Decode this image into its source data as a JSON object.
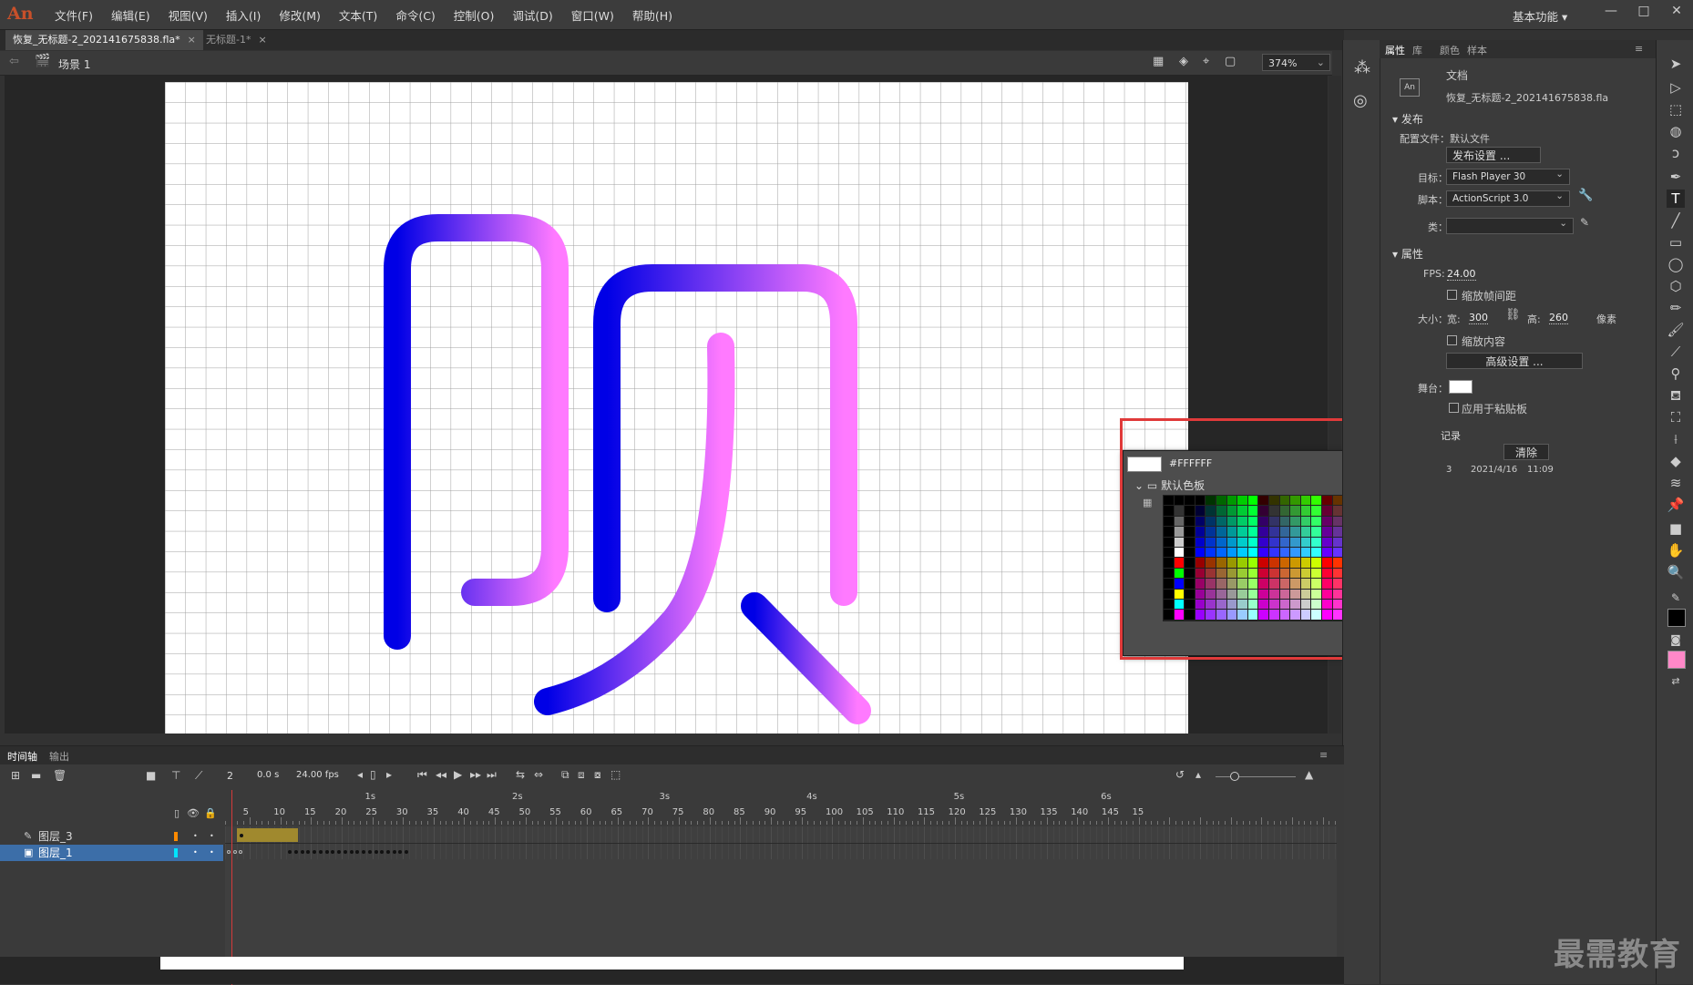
{
  "app": {
    "logo": "An",
    "menu": [
      "文件(F)",
      "编辑(E)",
      "视图(V)",
      "插入(I)",
      "修改(M)",
      "文本(T)",
      "命令(C)",
      "控制(O)",
      "调试(D)",
      "窗口(W)",
      "帮助(H)"
    ],
    "workspace": "基本功能",
    "window_buttons": [
      "—",
      "□",
      "✕"
    ]
  },
  "doc_tabs": [
    {
      "label": "恢复_无标题-2_202141675838.fla*",
      "close": "×"
    },
    {
      "label": "无标题-1*",
      "close": "×"
    }
  ],
  "edit_bar": {
    "scene": "场景 1",
    "zoom": "374%"
  },
  "stage": {
    "character": "帧",
    "gradient_start": "#0000e6",
    "gradient_end": "#ff7aff",
    "grid_color": "#a0a0a0",
    "background": "#ffffff"
  },
  "swatch_popup": {
    "hex": "#FFFFFF",
    "folder_label": "默认色板"
  },
  "properties_panel": {
    "tabs": [
      "属性",
      "库",
      "颜色",
      "样本"
    ],
    "doc_type": "文档",
    "file_name": "恢复_无标题-2_202141675838.fla",
    "publish": {
      "section": "发布",
      "profile_label": "配置文件：",
      "profile_value": "默认文件",
      "publish_settings_button": "发布设置 ...",
      "target_label": "目标：",
      "target_value": "Flash Player 30",
      "script_label": "脚本：",
      "script_value": "ActionScript 3.0",
      "class_label": "类："
    },
    "attributes": {
      "section": "属性",
      "fps_label": "FPS:",
      "fps_value": "24.00",
      "scale_spans_label": "缩放帧间距",
      "size_label": "大小：",
      "width_label": "宽:",
      "width_value": "300",
      "height_label": "高:",
      "height_value": "260",
      "unit": "像素",
      "scale_content_label": "缩放内容",
      "advanced_button": "高级设置 ...",
      "stage_label": "舞台：",
      "apply_pasteboard_label": "应用于粘贴板"
    },
    "history": {
      "section": "记录",
      "clear_button": "清除",
      "row_index": "3",
      "date": "2021/4/16",
      "time": "11:09"
    }
  },
  "timeline": {
    "tabs": [
      "时间轴",
      "输出"
    ],
    "current_frame": "2",
    "time": "0.0 s",
    "fps": "24.00 fps",
    "layers": [
      {
        "name": "图层_3",
        "color": "#ff8a00",
        "selected": false
      },
      {
        "name": "图层_1",
        "color": "#00e5ff",
        "selected": true
      }
    ],
    "frame_numbers": [
      "5",
      "10",
      "15",
      "20",
      "25",
      "30",
      "35",
      "40",
      "45",
      "50",
      "55",
      "60",
      "65",
      "70",
      "75",
      "80",
      "85",
      "90",
      "95",
      "100",
      "105",
      "110",
      "115",
      "120",
      "125",
      "130",
      "135",
      "140",
      "145",
      "15"
    ],
    "second_marks": [
      "1s",
      "2s",
      "3s",
      "4s",
      "5s",
      "6s"
    ]
  },
  "watermark": "最需教育"
}
